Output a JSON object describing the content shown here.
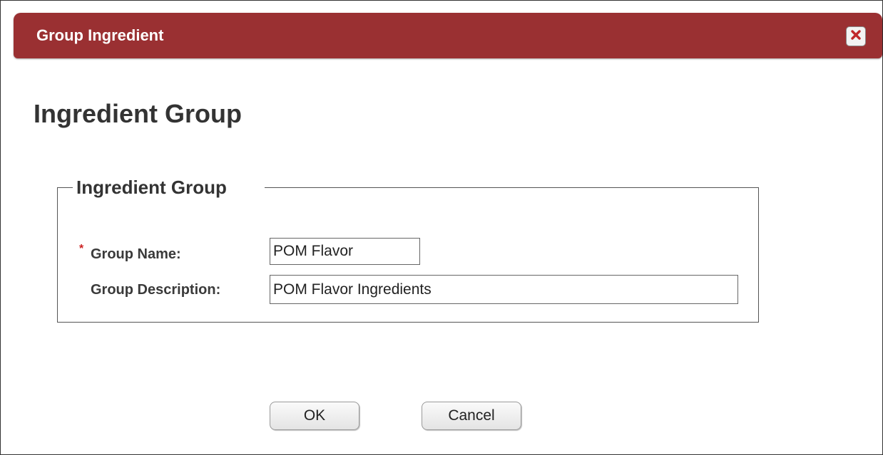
{
  "dialog": {
    "title": "Group Ingredient",
    "close_icon": "close-icon"
  },
  "page": {
    "title": "Ingredient Group"
  },
  "fieldset": {
    "legend": "Ingredient Group",
    "required_marker": "*",
    "group_name_label": "Group Name:",
    "group_name_value": "POM Flavor",
    "group_description_label": "Group Description:",
    "group_description_value": "POM Flavor Ingredients"
  },
  "buttons": {
    "ok_label": "OK",
    "cancel_label": "Cancel"
  },
  "colors": {
    "titlebar": "#9a3032",
    "required": "#cc2222",
    "close_x": "#c0282a"
  }
}
